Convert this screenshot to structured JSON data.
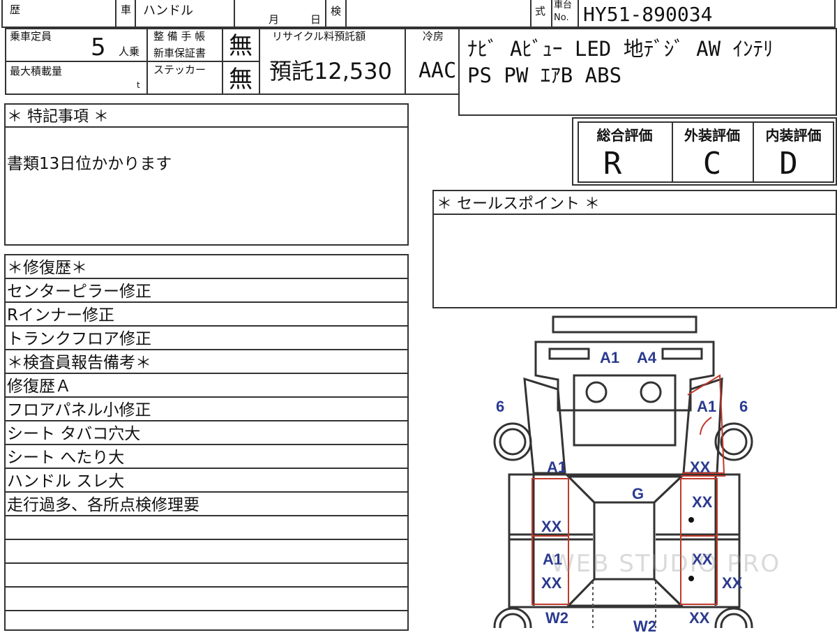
{
  "header": {
    "reki": "歴",
    "sha": "車",
    "handle": "ハンドル",
    "tsuki": "月",
    "hi": "日",
    "ken": "検",
    "shiki": "式",
    "chassis_label_top": "車台",
    "chassis_label_no": "No.",
    "chassis_no": "HY51-890034"
  },
  "specs": {
    "capacity_label": "乗車定員",
    "capacity_value": "5",
    "capacity_unit": "人乗",
    "maint_label_1": "整 備 手 帳",
    "maint_label_2": "新車保証書",
    "maint_value": "無",
    "load_label": "最大積載量",
    "load_unit": "t",
    "sticker_label": "ステッカー",
    "sticker_value": "無",
    "recycle_label": "リサイクル料預託額",
    "recycle_value": "預託12,530",
    "cooler_label": "冷房",
    "cooler_value": "AAC",
    "equipment_line1": "ﾅﾋﾞ Aﾋﾞｭｰ LED 地ﾃﾞｼﾞ AW ｲﾝﾃﾘ",
    "equipment_line2": "PS PW ｴｱB ABS"
  },
  "grades": {
    "overall_label": "総合評価",
    "overall_value": "R",
    "exterior_label": "外装評価",
    "exterior_value": "C",
    "interior_label": "内装評価",
    "interior_value": "D"
  },
  "notes": {
    "special_title": "＊ 特記事項 ＊",
    "special_text": "書類13日位かかります",
    "sales_title": "＊ セールスポイント ＊"
  },
  "history": {
    "repair_title": "＊修復歴＊",
    "repair_items": [
      "センターピラー修正",
      "Rインナー修正",
      "トランクフロア修正"
    ],
    "inspector_title": "＊検査員報告備考＊",
    "inspector_items": [
      "修復歴Ａ",
      "フロアパネル小修正",
      "シート タバコ穴大",
      "シート へたり大",
      "ハンドル スレ大",
      "走行過多、各所点検修理要"
    ]
  },
  "diagram_marks": {
    "front_a1": "A1",
    "front_a4": "A4",
    "left_front_6": "6",
    "right_front_a1": "A1",
    "right_front_6": "6",
    "left_a1": "A1",
    "right_xx_top": "XX",
    "roof_g": "G",
    "right_xx_2": "XX",
    "left_xx_1": "XX",
    "left_a1_2": "A1",
    "left_xx_2": "XX",
    "right_xx_3": "XX",
    "right_xx_outer": "XX",
    "left_w2": "W2",
    "rear_w2": "W2",
    "right_xx_bottom": "XX"
  },
  "watermark": "WEB STUDIO PRO",
  "colors": {
    "mark": "#2b3a8f",
    "damage": "#c0392b",
    "line": "#333333"
  }
}
